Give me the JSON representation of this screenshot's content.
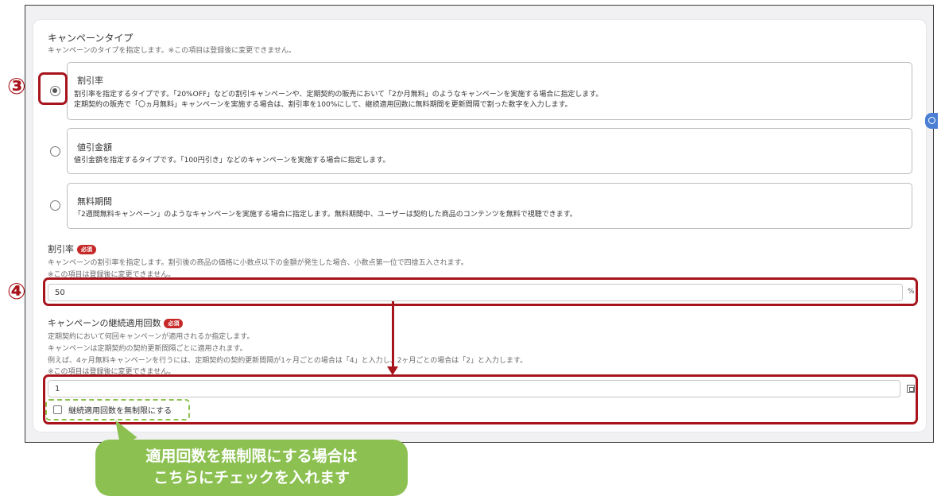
{
  "campaign_type": {
    "title": "キャンペーンタイプ",
    "desc": "キャンペーンのタイプを指定します。※この項目は登録後に変更できません。",
    "options": [
      {
        "label": "割引率",
        "desc_lines": [
          "割引率を指定するタイプです。「20%OFF」などの割引キャンペーンや、定期契約の販売において「2か月無料」のようなキャンペーンを実施する場合に指定します。",
          "定期契約の販売で「〇ヵ月無料」キャンペーンを実施する場合は、割引率を100%にして、継続適用回数に無料期間を更新間隔で割った数字を入力します。"
        ],
        "checked": true
      },
      {
        "label": "値引金額",
        "desc_lines": [
          "値引金額を指定するタイプです。「100円引き」などのキャンペーンを実施する場合に指定します。"
        ],
        "checked": false
      },
      {
        "label": "無料期間",
        "desc_lines": [
          "「2週間無料キャンペーン」のようなキャンペーンを実施する場合に指定します。無料期間中、ユーザーは契約した商品のコンテンツを無料で視聴できます。"
        ],
        "checked": false
      }
    ]
  },
  "discount_rate": {
    "title": "割引率",
    "required_badge": "必須",
    "desc_lines": [
      "キャンペーンの割引率を指定します。割引後の商品の価格に小数点以下の金額が発生した場合、小数点第一位で四捨五入されます。",
      "※この項目は登録後に変更できません。"
    ],
    "value": "50",
    "unit": "%"
  },
  "repeat_count": {
    "title": "キャンペーンの継続適用回数",
    "required_badge": "必須",
    "desc_lines": [
      "定期契約において何回キャンペーンが適用されるか指定します。",
      "キャンペーンは定期契約の契約更新間隔ごとに適用されます。",
      "例えば、4ヶ月無料キャンペーンを行うには、定期契約の契約更新間隔が1ヶ月ごとの場合は「4」と入力し、2ヶ月ごとの場合は「2」と入力します。",
      "※この項目は登録後に変更できません。"
    ],
    "value": "1",
    "unlimited_label": "継続適用回数を無制限にする",
    "unlimited_checked": false
  },
  "annotations": {
    "step3": "③",
    "step4": "④",
    "callout_line1": "適用回数を無制限にする場合は",
    "callout_line2": "こちらにチェックを入れます"
  },
  "colors": {
    "annotation_red": "#a8141c",
    "callout_green": "#8cc152",
    "badge_red": "#c62828"
  }
}
